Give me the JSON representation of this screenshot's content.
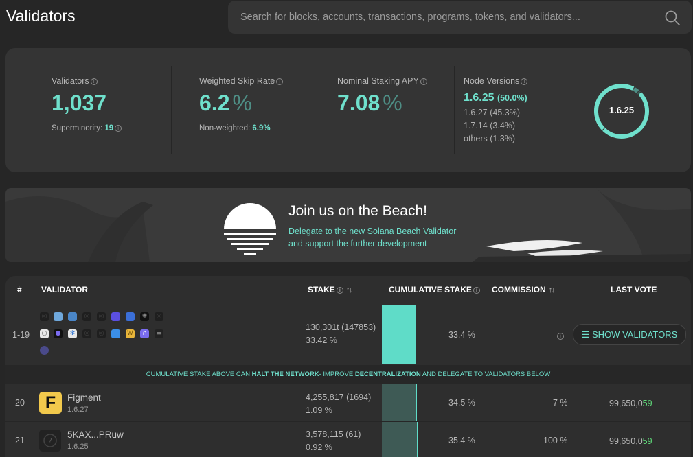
{
  "header": {
    "title": "Validators",
    "search_placeholder": "Search for blocks, accounts, transactions, programs, tokens, and validators..."
  },
  "stats": {
    "validators": {
      "label": "Validators",
      "value": "1,037",
      "sub_label": "Superminority:",
      "sub_value": "19"
    },
    "skip_rate": {
      "label": "Weighted Skip Rate",
      "value": "6.2",
      "unit": "%",
      "sub_label": "Non-weighted:",
      "sub_value": "6.9%"
    },
    "apy": {
      "label": "Nominal Staking APY",
      "value": "7.08",
      "unit": "%"
    },
    "node_versions": {
      "label": "Node Versions",
      "main_version": "1.6.25",
      "main_pct": "(50.0%)",
      "rows": [
        "1.6.27 (45.3%)",
        "1.7.14 (3.4%)",
        "others (1.3%)"
      ],
      "ring_label": "1.6.25",
      "ring_shares": [
        0.5,
        0.453,
        0.034,
        0.013
      ]
    }
  },
  "banner": {
    "title": "Join us on the Beach!",
    "line1": "Delegate to the new Solana Beach Validator",
    "line2": "and support the further development"
  },
  "table": {
    "headers": {
      "rank": "#",
      "validator": "VALIDATOR",
      "stake": "STAKE",
      "cumulative": "CUMULATIVE STAKE",
      "commission": "COMMISSION",
      "last_vote": "LAST VOTE"
    },
    "group": {
      "rank": "1-19",
      "stake": "130,301t",
      "stake_count": "(147853)",
      "stake_pct": "33.42 %",
      "cumulative": "33.4 %",
      "cumulative_fraction": 0.334,
      "button": "SHOW VALIDATORS"
    },
    "halt": {
      "p1": "CUMULATIVE STAKE ABOVE CAN ",
      "b1": "HALT THE NETWORK",
      "p2": "- IMPROVE ",
      "b2": "DECENTRALIZATION",
      "p3": " AND DELEGATE TO VALIDATORS BELOW"
    },
    "rows": [
      {
        "rank": "20",
        "logo": "F",
        "name": "Figment",
        "version": "1.6.27",
        "stake": "4,255,817",
        "stake_count": "(1694)",
        "stake_pct": "1.09 %",
        "cumulative": "34.5 %",
        "commission": "7 %",
        "vote_main": "99,650,0",
        "vote_hi": "59"
      },
      {
        "rank": "21",
        "logo": "?",
        "name": "5KAX...PRuw",
        "version": "1.6.25",
        "stake": "3,578,115",
        "stake_count": "(61)",
        "stake_pct": "0.92 %",
        "cumulative": "35.4 %",
        "commission": "100 %",
        "vote_main": "99,650,0",
        "vote_hi": "59"
      }
    ]
  },
  "colors": {
    "accent": "#6fe0cc",
    "accent_dim": "#4e8e85",
    "vote_green": "#5fdc7a",
    "background": "#262626",
    "panel": "#343434"
  }
}
